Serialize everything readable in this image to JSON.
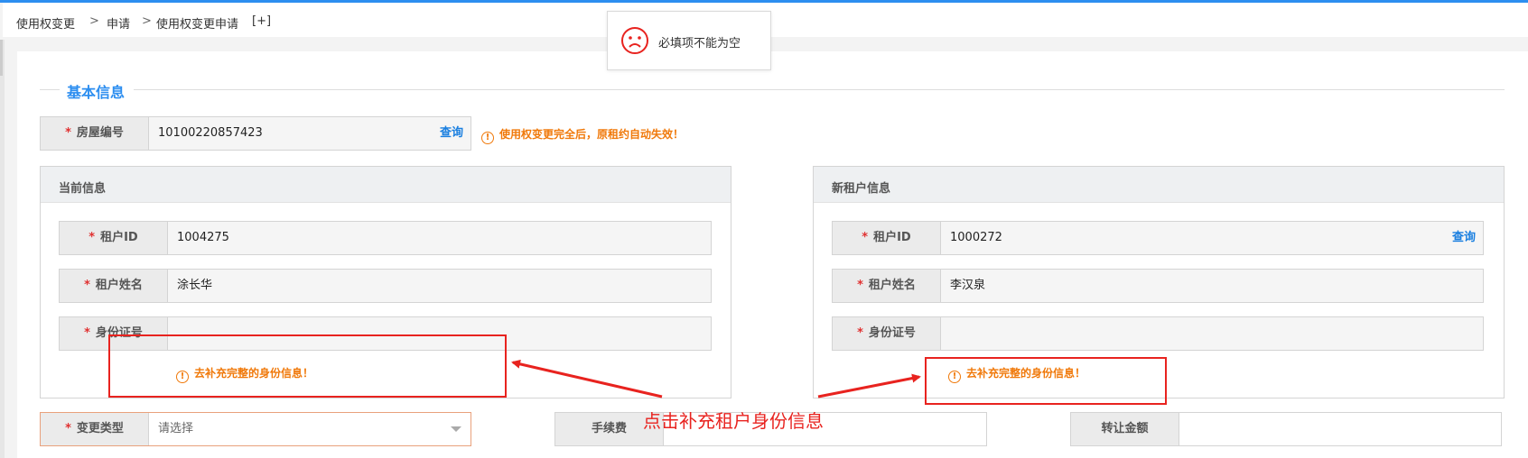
{
  "breadcrumb": [
    "使用权变更",
    "申请",
    "使用权变更申请",
    "[+]"
  ],
  "toast": {
    "message": "必填项不能为空",
    "icon": "sad-face-icon"
  },
  "section_title": "基本信息",
  "house": {
    "label": "房屋编号",
    "value": "10100220857423",
    "query": "查询",
    "notice": "使用权变更完全后，原租约自动失效！"
  },
  "current_panel": {
    "title": "当前信息",
    "fields": [
      {
        "label": "租户ID",
        "value": "1004275"
      },
      {
        "label": "租户姓名",
        "value": "涂长华"
      },
      {
        "label": "身份证号",
        "value": ""
      }
    ],
    "warning": "去补充完整的身份信息！"
  },
  "new_panel": {
    "title": "新租户信息",
    "fields": [
      {
        "label": "租户ID",
        "value": "1000272"
      },
      {
        "label": "租户姓名",
        "value": "李汉泉"
      },
      {
        "label": "身份证号",
        "value": ""
      }
    ],
    "query": "查询",
    "warning": "去补充完整的身份信息！"
  },
  "change_type": {
    "label": "变更类型",
    "placeholder": "请选择"
  },
  "fee": {
    "label": "手续费",
    "value": ""
  },
  "transfer_amount": {
    "label": "转让金额",
    "value": ""
  },
  "annotation": "点击补充租户身份信息",
  "colors": {
    "accent": "#2c8ef0",
    "warning": "#f0790a",
    "annotation": "#e8231f",
    "required": "#e03131"
  }
}
